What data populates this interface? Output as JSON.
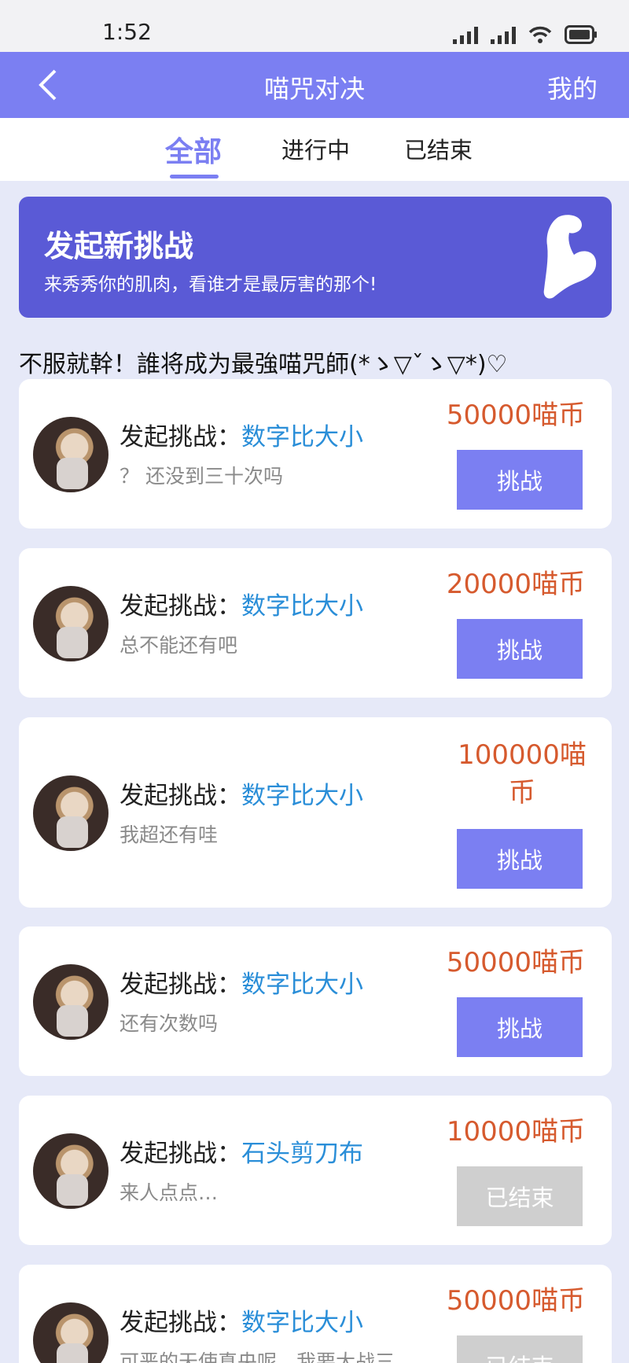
{
  "status": {
    "time": "1:52"
  },
  "nav": {
    "title": "喵咒对决",
    "mine": "我的"
  },
  "tabs": [
    {
      "label": "全部",
      "active": true
    },
    {
      "label": "进行中",
      "active": false
    },
    {
      "label": "已结束",
      "active": false
    }
  ],
  "banner": {
    "title": "发起新挑战",
    "subtitle": "来秀秀你的肌肉，看谁才是最厉害的那个!"
  },
  "slogan": "不服就幹！誰将成为最強喵咒師(*ゝ▽ˇゝ▽*)♡",
  "colors": {
    "accent": "#7b7ff2",
    "banner": "#5a5ad6",
    "prize": "#d65a2e",
    "game": "#2a8ed8"
  },
  "challenge_prefix": "发起挑战：",
  "challenges": [
    {
      "game": "数字比大小",
      "message": "？ 还没到三十次吗",
      "prize": "50000喵币",
      "action": "挑战",
      "ended": false
    },
    {
      "game": "数字比大小",
      "message": "总不能还有吧",
      "prize": "20000喵币",
      "action": "挑战",
      "ended": false
    },
    {
      "game": "数字比大小",
      "message": "我超还有哇",
      "prize": "100000喵币",
      "action": "挑战",
      "ended": false
    },
    {
      "game": "数字比大小",
      "message": "还有次数吗",
      "prize": "50000喵币",
      "action": "挑战",
      "ended": false
    },
    {
      "game": "石头剪刀布",
      "message": "来人点点…",
      "prize": "10000喵币",
      "action": "已结束",
      "ended": true
    },
    {
      "game": "数字比大小",
      "message": "可恶的天使真央呢，我要大战三",
      "prize": "50000喵币",
      "action": "已结束",
      "ended": true
    }
  ]
}
